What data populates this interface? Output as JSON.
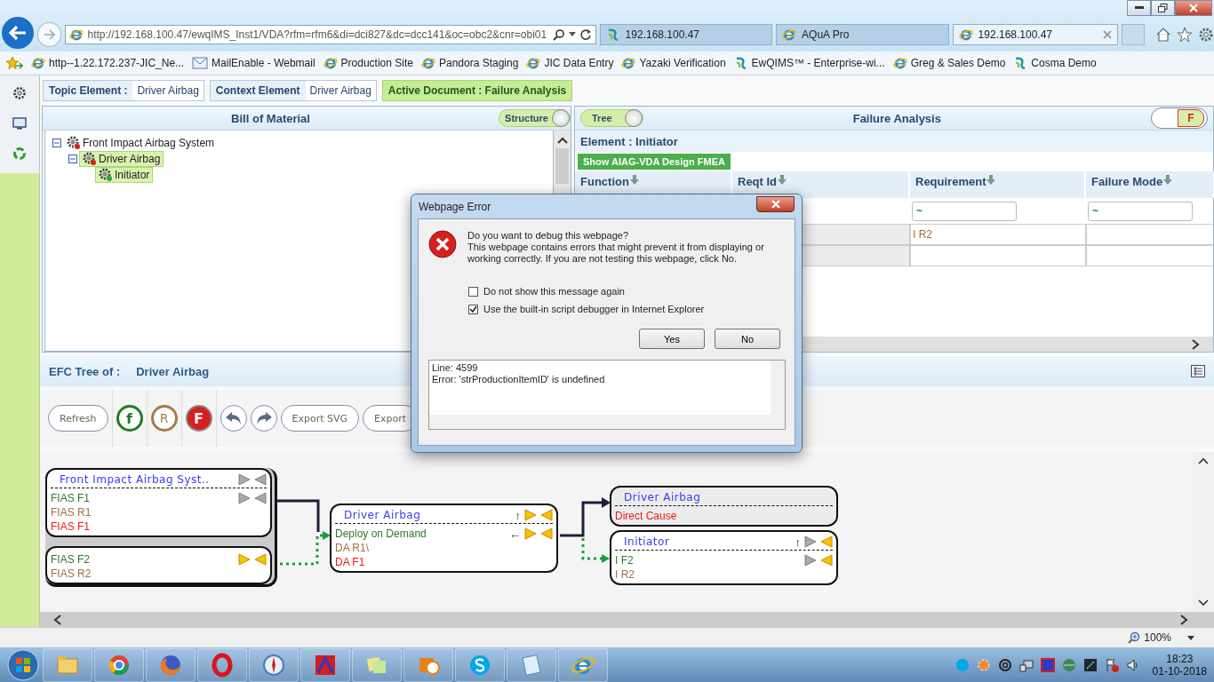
{
  "browser": {
    "tabs": [
      {
        "title": "192.168.100.47",
        "kind": "ewq",
        "selected": false
      },
      {
        "title": "AQuA Pro",
        "kind": "ie",
        "selected": false
      },
      {
        "title": "192.168.100.47",
        "kind": "ie",
        "selected": true
      }
    ],
    "address": "http://192.168.100.47/ewqIMS_Inst1/VDA?rfm=rfm6&di=dci827&dc=dcc141&oc=obc2&cnr=obi01",
    "bookmarks": [
      {
        "label": "http--1.22.172.237-JIC_Ne...",
        "kind": "ie"
      },
      {
        "label": "MailEnable - Webmail",
        "kind": "mail"
      },
      {
        "label": "Production Site",
        "kind": "ie"
      },
      {
        "label": "Pandora Staging",
        "kind": "ie"
      },
      {
        "label": "JIC Data Entry",
        "kind": "ie"
      },
      {
        "label": "Yazaki Verification",
        "kind": "ie"
      },
      {
        "label": "EwQIMS™ - Enterprise-wi...",
        "kind": "ewq"
      },
      {
        "label": "Greg & Sales Demo",
        "kind": "ie"
      },
      {
        "label": "Cosma Demo",
        "kind": "ewq"
      }
    ]
  },
  "info_bar": [
    {
      "label": "Topic Element :",
      "value": "Driver Airbag"
    },
    {
      "label": "Context Element",
      "value": "Driver Airbag"
    }
  ],
  "active_document": "Active Document : Failure Analysis",
  "bom": {
    "title": "Bill of Material",
    "toggle": "Structure",
    "tree": [
      {
        "label": "Front Impact Airbag System",
        "selected": false,
        "expanded": true,
        "children": [
          {
            "label": "Driver Airbag",
            "selected": true,
            "expanded": true,
            "children": [
              {
                "label": "Initiator",
                "selected": true
              }
            ]
          }
        ]
      }
    ]
  },
  "failure_analysis": {
    "toggle": "Tree",
    "title": "Failure Analysis",
    "badge": "F",
    "element": "Element : Initiator",
    "action": "Show AIAG-VDA Design FMEA",
    "columns": [
      "Function",
      "Reqt Id",
      "Requirement",
      "Failure Mode"
    ],
    "filters": [
      "~",
      "~"
    ],
    "rows": [
      [
        "",
        "",
        "I R2",
        ""
      ],
      [
        "",
        "",
        "",
        ""
      ]
    ]
  },
  "efc": {
    "label": "EFC Tree of :",
    "element": "Driver Airbag",
    "tools": [
      {
        "kind": "text",
        "label": "Refresh"
      },
      {
        "kind": "function",
        "label": "f"
      },
      {
        "kind": "requirement",
        "label": "R"
      },
      {
        "kind": "failure",
        "label": "F"
      },
      {
        "kind": "undo"
      },
      {
        "kind": "redo"
      },
      {
        "kind": "text",
        "label": "Export SVG"
      },
      {
        "kind": "text",
        "label": "Export"
      }
    ],
    "nodes": [
      {
        "title": "Front Impact Airbag Syst..",
        "shaded": false,
        "controls": {
          "right_on": false,
          "left_on": false
        },
        "sections": [
          {
            "lines": [
              {
                "text": "FIAS F1",
                "kind": "function",
                "controls": {
                  "right_on": false,
                  "left_on": false
                }
              },
              {
                "text": "FIAS R1",
                "kind": "requirement"
              },
              {
                "text": "FIAS F1",
                "kind": "failure"
              }
            ]
          },
          {
            "lines": [
              {
                "text": "FIAS F2",
                "kind": "function",
                "controls": {
                  "right_on": true,
                  "left_on": true
                }
              },
              {
                "text": "FIAS R2",
                "kind": "requirement"
              }
            ]
          }
        ]
      },
      {
        "title": "Driver Airbag",
        "shaded": false,
        "controls": {
          "arrow": "↑",
          "right_on": true,
          "left_on": true
        },
        "sections": [
          {
            "lines": [
              {
                "text": "Deploy on Demand",
                "kind": "function",
                "controls": {
                  "arrow": "←",
                  "right_on": true,
                  "left_on": true
                }
              },
              {
                "text": "DA R1\\",
                "kind": "requirement"
              },
              {
                "text": "DA F1",
                "kind": "failure"
              }
            ]
          }
        ]
      },
      {
        "title": "Driver Airbag",
        "shaded": true,
        "sections": [
          {
            "lines": [
              {
                "text": "Direct Cause",
                "kind": "failure"
              }
            ]
          }
        ]
      },
      {
        "title": "Initiator",
        "shaded": false,
        "controls": {
          "arrow": "↑",
          "right_on": false,
          "left_on": true
        },
        "sections": [
          {
            "lines": [
              {
                "text": "I F2",
                "kind": "function",
                "controls": {
                  "right_on": false,
                  "left_on": true
                }
              },
              {
                "text": "I R2",
                "kind": "requirement"
              }
            ]
          }
        ]
      }
    ]
  },
  "dialog": {
    "title": "Webpage Error",
    "question": "Do you want to debug this webpage?",
    "message": "This webpage contains errors that might prevent it from displaying or working correctly. If you are not testing this webpage, click No.",
    "options": [
      {
        "label": "Do not show this message again",
        "checked": false
      },
      {
        "label": "Use the built-in script debugger in Internet Explorer",
        "checked": true
      }
    ],
    "buttons": [
      "Yes",
      "No"
    ],
    "details": [
      "Line: 4599",
      "Error: 'strProductionItemID' is undefined"
    ]
  },
  "status_bar": {
    "zoom": "100%"
  },
  "taskbar": {
    "time": "18:23",
    "date": "01-10-2018"
  }
}
